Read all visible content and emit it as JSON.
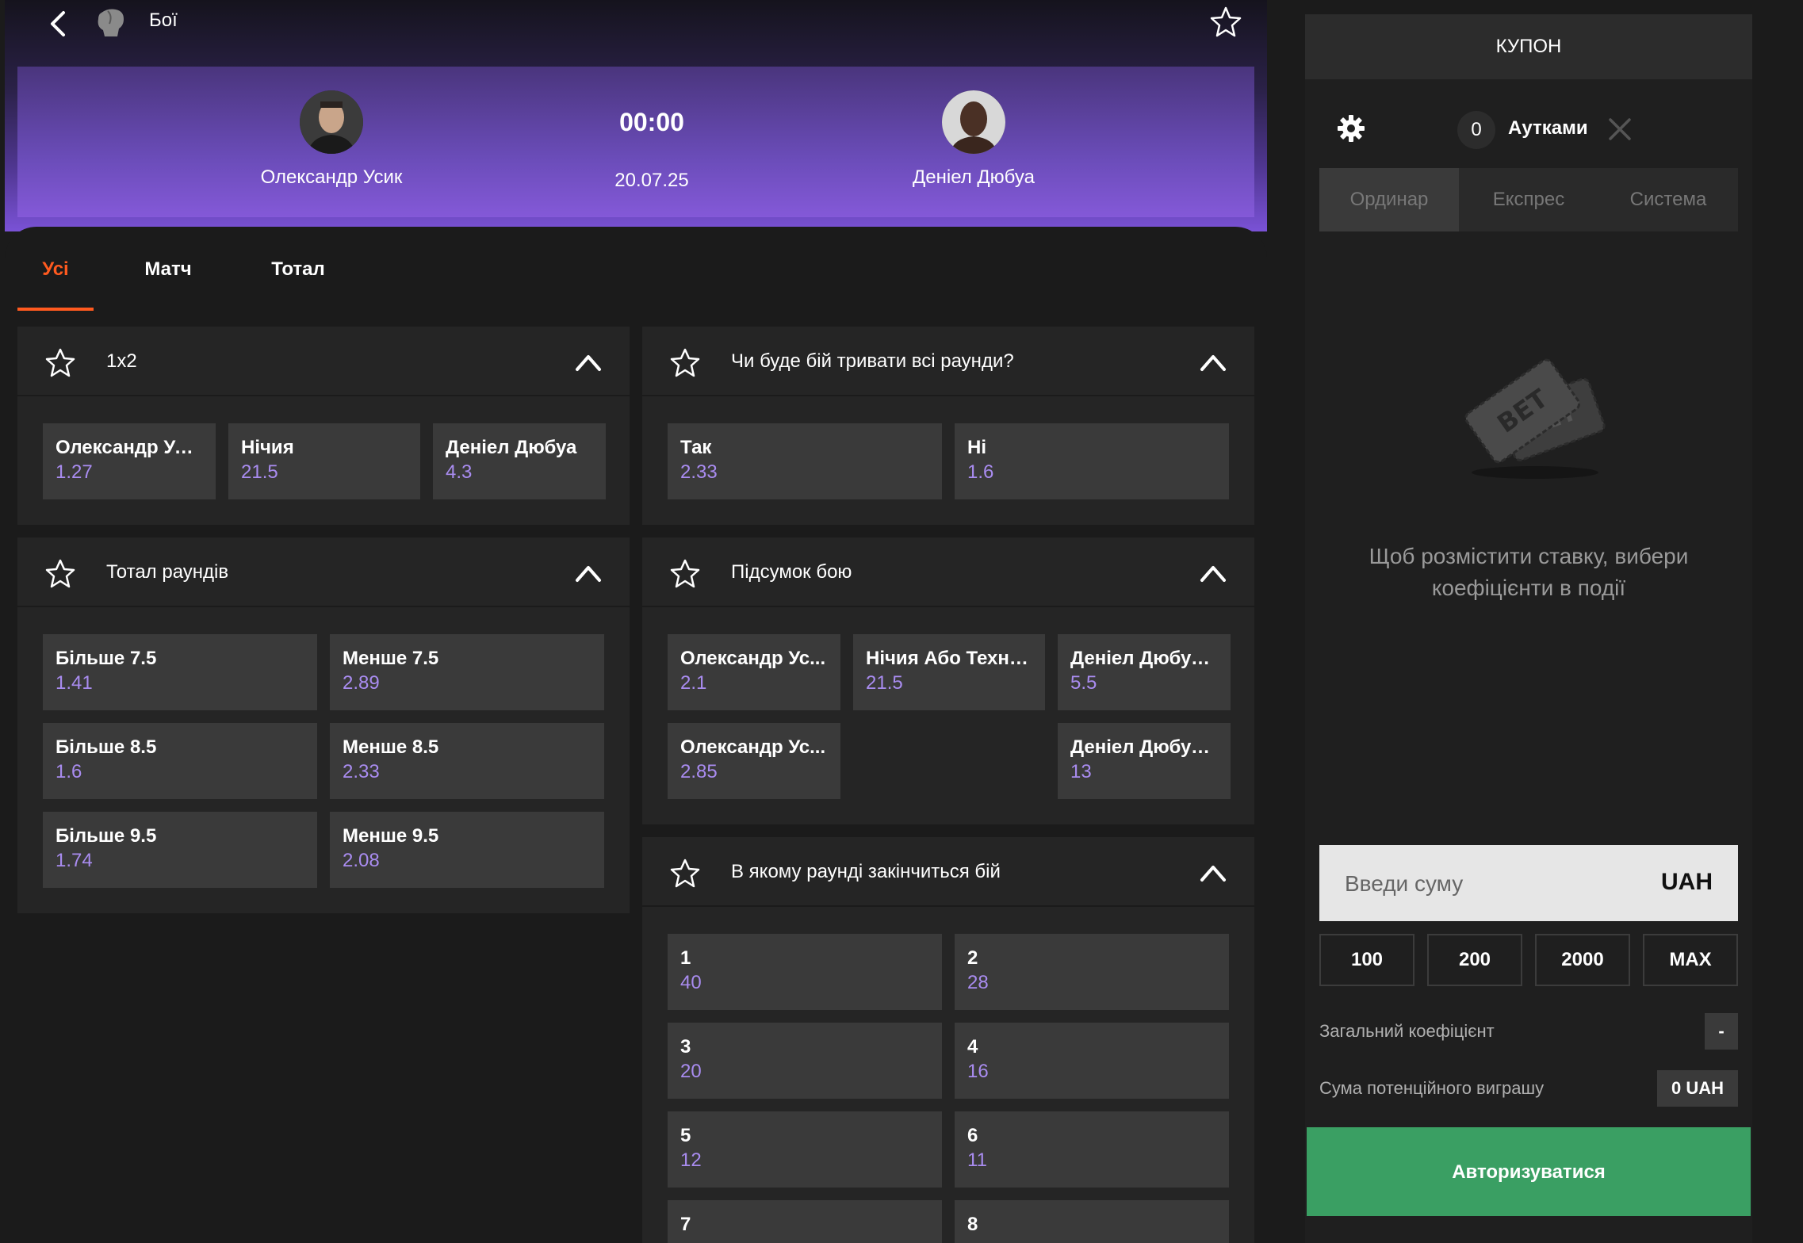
{
  "topbar": {
    "title": "Бої"
  },
  "event": {
    "team1": "Олександр Усик",
    "team2": "Деніел Дюбуа",
    "time": "00:00",
    "date": "20.07.25"
  },
  "tabs": [
    "Усі",
    "Матч",
    "Тотал"
  ],
  "markets": {
    "m1x2": {
      "title": "1x2",
      "odds": [
        {
          "name": "Олександр Усик",
          "value": "1.27"
        },
        {
          "name": "Нічия",
          "value": "21.5"
        },
        {
          "name": "Деніел Дюбуа",
          "value": "4.3"
        }
      ]
    },
    "all_rounds": {
      "title": "Чи буде бій тривати всі раунди?",
      "odds": [
        {
          "name": "Так",
          "value": "2.33"
        },
        {
          "name": "Ні",
          "value": "1.6"
        }
      ]
    },
    "total_rounds": {
      "title": "Тотал раундів",
      "odds": [
        {
          "name": "Більше 7.5",
          "value": "1.41"
        },
        {
          "name": "Менше 7.5",
          "value": "2.89"
        },
        {
          "name": "Більше 8.5",
          "value": "1.6"
        },
        {
          "name": "Менше 8.5",
          "value": "2.33"
        },
        {
          "name": "Більше 9.5",
          "value": "1.74"
        },
        {
          "name": "Менше 9.5",
          "value": "2.08"
        }
      ]
    },
    "fight_result": {
      "title": "Підсумок бою",
      "odds": [
        {
          "name": "Олександр Ус...",
          "value": "2.1"
        },
        {
          "name": "Нічия Або Техніч...",
          "value": "21.5"
        },
        {
          "name": "Деніел Дюбуа ...",
          "value": "5.5"
        },
        {
          "name": "Олександр Ус...",
          "value": "2.85"
        },
        {
          "name": "Деніел Дюбуа ...",
          "value": "13"
        }
      ]
    },
    "round_end": {
      "title": "В якому раунді закінчиться бій",
      "odds": [
        {
          "name": "1",
          "value": "40"
        },
        {
          "name": "2",
          "value": "28"
        },
        {
          "name": "3",
          "value": "20"
        },
        {
          "name": "4",
          "value": "16"
        },
        {
          "name": "5",
          "value": "12"
        },
        {
          "name": "6",
          "value": "11"
        },
        {
          "name": "7",
          "value": ""
        },
        {
          "name": "8",
          "value": ""
        }
      ]
    }
  },
  "coupon": {
    "title": "КУПОН",
    "count": "0",
    "outs_label": "Аутками",
    "bet_tabs": [
      "Ординар",
      "Експрес",
      "Система"
    ],
    "empty_message": "Щоб розмістити ставку, вибери коефіцієнти в події",
    "amount_placeholder": "Введи суму",
    "currency": "UAH",
    "quick_amounts": [
      "100",
      "200",
      "2000",
      "MAX"
    ],
    "total_coef_label": "Загальний коефіцієнт",
    "total_coef_value": "-",
    "potential_win_label": "Сума потенційного виграшу",
    "potential_win_value": "0 UAH",
    "auth_button": "Авторизуватися"
  },
  "colors": {
    "accent": "#ff5a1f",
    "odd_value": "#a98cf0",
    "auth": "#3a9f63"
  },
  "icons": [
    "back-icon",
    "boxing-glove-icon",
    "star-icon",
    "chevron-up-icon",
    "gear-icon",
    "close-icon",
    "bet-ticket-icon"
  ]
}
